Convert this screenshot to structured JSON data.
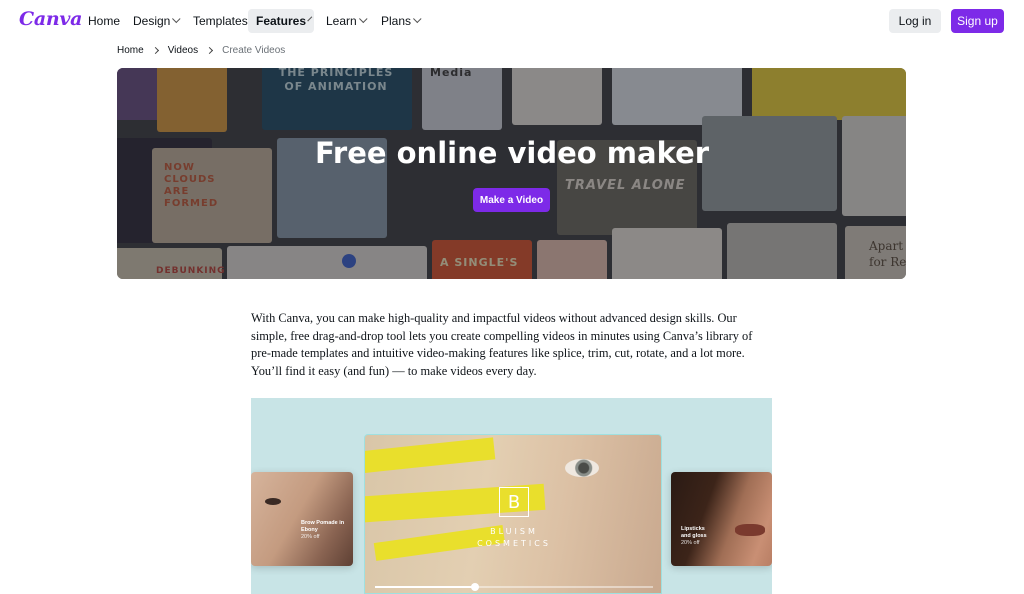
{
  "nav": {
    "logo": "Canva",
    "items": [
      {
        "label": "Home",
        "has_caret": false,
        "active": false
      },
      {
        "label": "Design",
        "has_caret": true,
        "active": false
      },
      {
        "label": "Templates",
        "has_caret": false,
        "active": false
      },
      {
        "label": "Features",
        "has_caret": true,
        "active": true
      },
      {
        "label": "Learn",
        "has_caret": true,
        "active": false
      },
      {
        "label": "Plans",
        "has_caret": true,
        "active": false
      }
    ],
    "login_label": "Log in",
    "signup_label": "Sign up"
  },
  "breadcrumb": {
    "items": [
      "Home",
      "Videos"
    ],
    "current": "Create Videos"
  },
  "hero": {
    "title": "Free online video maker",
    "button_label": "Make a Video",
    "tile_texts": [
      "THE PRINCIPLES OF ANIMATION",
      "Media",
      "NOW CLOUDS ARE FORMED",
      "TRAVEL ALONE",
      "A SINGLE'S",
      "DEBUNKING",
      "Apart for Re"
    ]
  },
  "intro": {
    "paragraph": "With Canva, you can make high-quality and impactful videos without advanced design skills. Our simple, free drag-and-drop tool lets you create compelling videos in minutes using Canva’s library of pre-made templates and intuitive video-making features like splice, trim, cut, rotate, and a lot more. You’ll find it easy (and fun) — to make videos every day."
  },
  "preview": {
    "left_card": {
      "title": "Brow Pomade in Ebony",
      "sub": "20% off"
    },
    "right_card": {
      "title": "Lipsticks and gloss",
      "sub": "20% off"
    },
    "main_card": {
      "monogram": "B",
      "brand_line1": "BLUISM",
      "brand_line2": "COSMETICS"
    },
    "playback_progress": 0.36
  },
  "colors": {
    "brand_purple": "#7d2ae8",
    "preview_bg": "#c8e4e6"
  }
}
